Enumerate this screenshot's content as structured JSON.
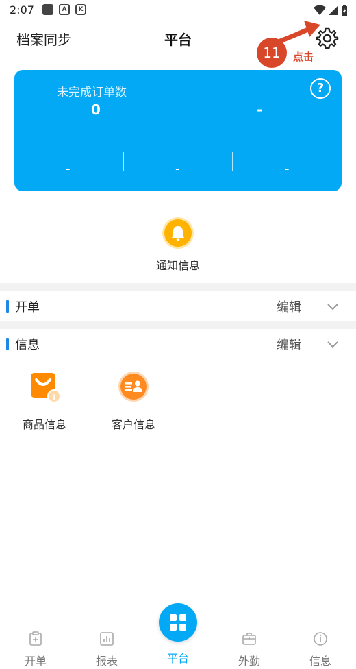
{
  "status_bar": {
    "time": "2:07"
  },
  "header": {
    "left_label": "档案同步",
    "title": "平台"
  },
  "annotation": {
    "step": "11",
    "text": "点击"
  },
  "stats": {
    "title": "未完成订单数",
    "value_left": "0",
    "value_right": "-",
    "sub_values": [
      "-",
      "-",
      "-"
    ]
  },
  "notice": {
    "label": "通知信息"
  },
  "sections": [
    {
      "title": "开单",
      "edit": "编辑"
    },
    {
      "title": "信息",
      "edit": "编辑"
    }
  ],
  "info_items": [
    {
      "label": "商品信息",
      "icon": "shopping-bag-info-icon"
    },
    {
      "label": "客户信息",
      "icon": "customer-info-icon"
    }
  ],
  "nav": [
    {
      "label": "开单",
      "icon": "order-add-icon"
    },
    {
      "label": "报表",
      "icon": "report-chart-icon"
    },
    {
      "label": "平台",
      "icon": "platform-grid-icon"
    },
    {
      "label": "外勤",
      "icon": "briefcase-icon"
    },
    {
      "label": "信息",
      "icon": "info-icon"
    }
  ],
  "colors": {
    "accent": "#03a9f4",
    "annotation_red": "#d9472b",
    "bell_orange": "#ffb300",
    "section_bar": "#1e88e5"
  }
}
